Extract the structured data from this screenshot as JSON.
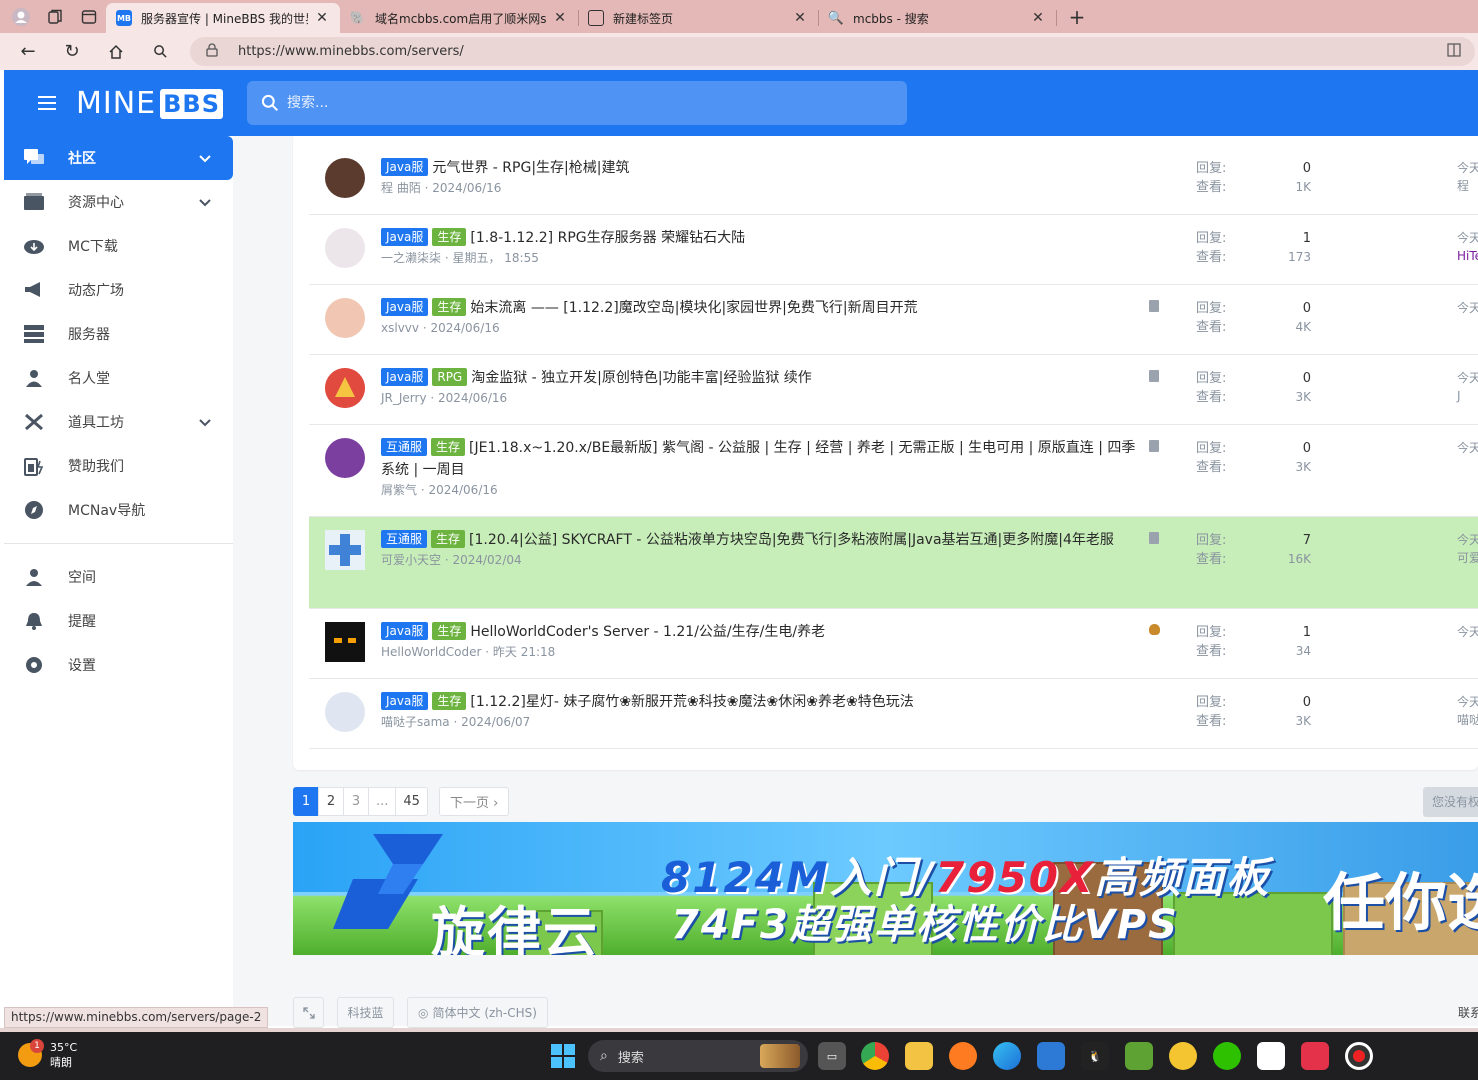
{
  "browser": {
    "tabs": [
      {
        "title": "服务器宣传 | MineBBS 我的世界中",
        "favicon": "MB",
        "color": "#1e77f0",
        "active": true
      },
      {
        "title": "域名mcbbs.com启用了顺米网shun",
        "favicon": "",
        "color": "#4b8fe0",
        "active": false
      },
      {
        "title": "新建标签页",
        "favicon": "",
        "color": "#444",
        "active": false
      },
      {
        "title": "mcbbs - 搜索",
        "favicon": "",
        "color": "#1e77f0",
        "active": false
      }
    ],
    "url": "https://www.minebbs.com/servers/"
  },
  "header": {
    "logo_main": "MINE",
    "logo_badge": "BBS",
    "search_placeholder": "搜索..."
  },
  "sidebar": {
    "items": [
      {
        "label": "社区",
        "icon": "forum-icon",
        "active": true,
        "expandable": true
      },
      {
        "label": "资源中心",
        "icon": "resource-icon",
        "active": false,
        "expandable": true
      },
      {
        "label": "MC下载",
        "icon": "cloud-download-icon",
        "active": false,
        "expandable": false
      },
      {
        "label": "动态广场",
        "icon": "megaphone-icon",
        "active": false,
        "expandable": false
      },
      {
        "label": "服务器",
        "icon": "server-icon",
        "active": false,
        "expandable": false
      },
      {
        "label": "名人堂",
        "icon": "person-icon",
        "active": false,
        "expandable": false
      },
      {
        "label": "道具工坊",
        "icon": "tools-icon",
        "active": false,
        "expandable": true
      },
      {
        "label": "赞助我们",
        "icon": "battery-icon",
        "active": false,
        "expandable": false
      },
      {
        "label": "MCNav导航",
        "icon": "compass-icon",
        "active": false,
        "expandable": false
      }
    ],
    "account_items": [
      {
        "label": "空间",
        "icon": "user-icon"
      },
      {
        "label": "提醒",
        "icon": "bell-icon"
      },
      {
        "label": "设置",
        "icon": "gear-icon"
      }
    ]
  },
  "threads": {
    "reply_label": "回复:",
    "view_label": "查看:",
    "rows": [
      {
        "badges": [
          {
            "text": "Java服",
            "color": "blue"
          }
        ],
        "title": "元气世界 - RPG|生存|枪械|建筑",
        "author": "程 曲陌",
        "date": "2024/06/16",
        "replies": "0",
        "views": "1K",
        "last_time": "今天",
        "last_user": "程",
        "has_doc": false,
        "sticky": false,
        "two_line": false,
        "avatar_color": "#5a3b2e"
      },
      {
        "badges": [
          {
            "text": "Java服",
            "color": "blue"
          },
          {
            "text": "生存",
            "color": "green"
          }
        ],
        "title": "[1.8-1.12.2] RPG生存服务器 荣耀钻石大陆",
        "author": "一之濑柒柒",
        "date": "星期五， 18:55",
        "replies": "1",
        "views": "173",
        "last_time": "今天",
        "last_user": "HiTe",
        "has_doc": false,
        "sticky": false,
        "two_line": false,
        "avatar_color": "#ece6ea"
      },
      {
        "badges": [
          {
            "text": "Java服",
            "color": "blue"
          },
          {
            "text": "生存",
            "color": "green"
          }
        ],
        "title": "始末流离 —— [1.12.2]魔改空岛|模块化|家园世界|免费飞行|新周目开荒",
        "author": "xslvvv",
        "date": "2024/06/16",
        "replies": "0",
        "views": "4K",
        "last_time": "今天",
        "last_user": "",
        "has_doc": true,
        "sticky": false,
        "two_line": false,
        "avatar_color": "#f1c7b3"
      },
      {
        "badges": [
          {
            "text": "Java服",
            "color": "blue"
          },
          {
            "text": "RPG",
            "color": "green"
          }
        ],
        "title": "淘金监狱 - 独立开发|原创特色|功能丰富|经验监狱 续作",
        "author": "JR_Jerry",
        "date": "2024/06/16",
        "replies": "0",
        "views": "3K",
        "last_time": "今天",
        "last_user": "J",
        "has_doc": true,
        "sticky": false,
        "two_line": false,
        "avatar_color": "#e04a3f"
      },
      {
        "badges": [
          {
            "text": "互通服",
            "color": "blue"
          },
          {
            "text": "生存",
            "color": "green"
          }
        ],
        "title": "[JE1.18.x~1.20.x/BE最新版] 紫气阁 - 公益服 | 生存 | 经营 | 养老 | 无需正版 | 生电可用 | 原版直连 | 四季系统 | 一周目",
        "author": "屑紫气",
        "date": "2024/06/16",
        "replies": "0",
        "views": "3K",
        "last_time": "今天",
        "last_user": "",
        "has_doc": true,
        "sticky": false,
        "two_line": true,
        "avatar_color": "#7b3fa0"
      },
      {
        "badges": [
          {
            "text": "互通服",
            "color": "blue"
          },
          {
            "text": "生存",
            "color": "green"
          }
        ],
        "title": "[1.20.4|公益] SKYCRAFT - 公益粘液单方块空岛|免费飞行|多粘液附属|Java基岩互通|更多附魔|4年老服",
        "author": "可爱小天空",
        "date": "2024/02/04",
        "replies": "7",
        "views": "16K",
        "last_time": "今天",
        "last_user": "可爱",
        "has_doc": true,
        "sticky": true,
        "two_line": true,
        "avatar_color": "#e8f0f8"
      },
      {
        "badges": [
          {
            "text": "Java服",
            "color": "blue"
          },
          {
            "text": "生存",
            "color": "green"
          }
        ],
        "title": "HelloWorldCoder's Server - 1.21/公益/生存/生电/养老",
        "author": "HelloWorldCoder",
        "date": "昨天 21:18",
        "replies": "1",
        "views": "34",
        "last_time": "今天",
        "last_user": "",
        "has_doc": false,
        "sticky": false,
        "two_line": false,
        "avatar_color": "#111111"
      },
      {
        "badges": [
          {
            "text": "Java服",
            "color": "blue"
          },
          {
            "text": "生存",
            "color": "green"
          }
        ],
        "title": "[1.12.2]星灯- 妹子腐竹❀新服开荒❀科技❀魔法❀休闲❀养老❀特色玩法",
        "author": "喵哒子sama",
        "date": "2024/06/07",
        "replies": "0",
        "views": "3K",
        "last_time": "今天",
        "last_user": "喵哒",
        "has_doc": false,
        "sticky": false,
        "two_line": false,
        "avatar_color": "#dfe6f2"
      }
    ]
  },
  "pagination": {
    "pages": [
      "1",
      "2",
      "3",
      "...",
      "45"
    ],
    "next_label": "下一页 ›",
    "no_permission": "您没有权限"
  },
  "banner": {
    "brand": "旋律云",
    "line1_a": "8124M",
    "line1_b": "入门/",
    "line1_c": "7950X",
    "line1_d": "高频面板",
    "line2": "74F3超强单核性价比VPS",
    "line3": "任你选"
  },
  "footer": {
    "theme": "科技蓝",
    "language": "简体中文 (zh-CHS)",
    "contact": "联系",
    "status_url": "https://www.minebbs.com/servers/page-2"
  },
  "taskbar": {
    "weather_temp": "35°C",
    "weather_desc": "晴朗",
    "notify": "1",
    "search_label": "搜索"
  }
}
